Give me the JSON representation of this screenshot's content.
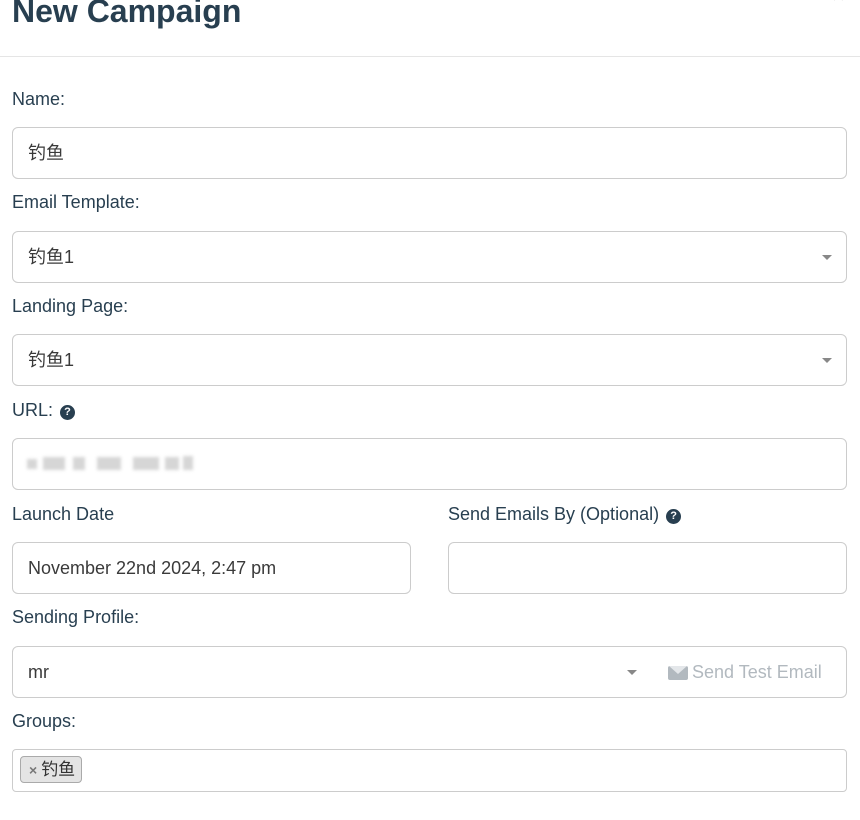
{
  "header": {
    "title": "New Campaign",
    "close": "×"
  },
  "form": {
    "name": {
      "label": "Name:",
      "value": "钓鱼"
    },
    "email_template": {
      "label": "Email Template:",
      "value": "钓鱼1"
    },
    "landing_page": {
      "label": "Landing Page:",
      "value": "钓鱼1"
    },
    "url": {
      "label": "URL:"
    },
    "launch_date": {
      "label": "Launch Date",
      "value": "November 22nd 2024, 2:47 pm"
    },
    "send_by": {
      "label": "Send Emails By (Optional)",
      "value": ""
    },
    "sending_profile": {
      "label": "Sending Profile:",
      "value": "mr"
    },
    "send_test": {
      "label": "Send Test Email"
    },
    "groups": {
      "label": "Groups:",
      "tags": [
        {
          "remove": "×",
          "label": "钓鱼"
        }
      ]
    }
  },
  "icons": {
    "help": "question-circle-icon",
    "envelope": "envelope-icon",
    "caret": "caret-down-icon",
    "close": "close-icon"
  },
  "colors": {
    "heading": "#283f50",
    "border": "#cccccc",
    "muted_button_text": "#b2b9bf",
    "tag_bg": "#e4e4e4"
  }
}
